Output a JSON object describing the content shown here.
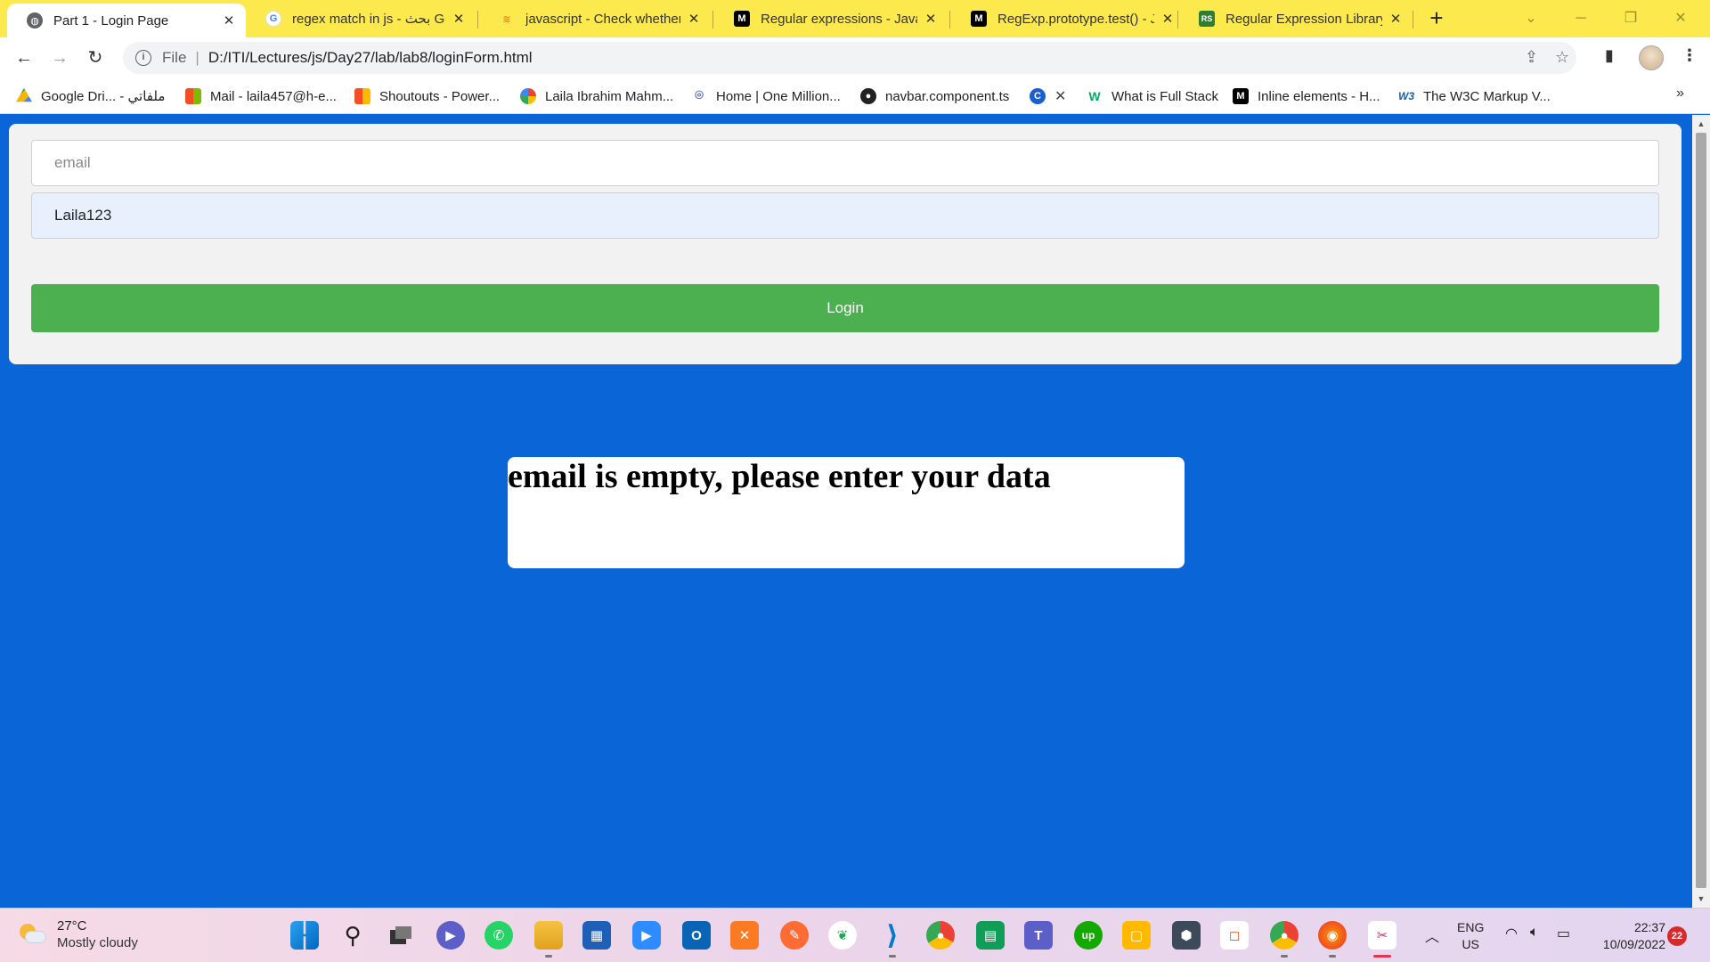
{
  "tabs": [
    {
      "title": "Part 1 - Login Page",
      "icon": "globe-icon",
      "active": true
    },
    {
      "title": "regex match in js - بحث Goo",
      "icon": "google-icon",
      "active": false
    },
    {
      "title": "javascript - Check whether a",
      "icon": "stackoverflow-icon",
      "active": false
    },
    {
      "title": "Regular expressions - JavaS",
      "icon": "mdn-icon",
      "active": false
    },
    {
      "title": "RegExp.prototype.test() - Ja",
      "icon": "mdn-icon",
      "active": false
    },
    {
      "title": "Regular Expression Library",
      "icon": "regexlib-icon",
      "active": false
    }
  ],
  "toolbar": {
    "scheme": "File",
    "url": "D:/ITI/Lectures/js/Day27/lab/lab8/loginForm.html"
  },
  "bookmarks": [
    {
      "label": "Google Dri... - ملفاتي",
      "icon": "google-drive-icon"
    },
    {
      "label": "Mail - laila457@h-e...",
      "icon": "microsoft-icon"
    },
    {
      "label": "Shoutouts - Power...",
      "icon": "microsoft-icon"
    },
    {
      "label": "Laila Ibrahim Mahm...",
      "icon": "pinwheel-icon"
    },
    {
      "label": "Home | One Million...",
      "icon": "location-icon"
    },
    {
      "label": "navbar.component.ts",
      "icon": "github-icon"
    },
    {
      "label": "",
      "icon": "c-logo-icon"
    },
    {
      "label": "",
      "icon": "close-icon"
    },
    {
      "label": "What is Full Stack",
      "icon": "w3-logo-icon"
    },
    {
      "label": "Inline elements - H...",
      "icon": "mdn-icon"
    },
    {
      "label": "The W3C Markup V...",
      "icon": "w3c-icon"
    }
  ],
  "form": {
    "email_placeholder": "email",
    "email_value": "",
    "password_value": "Laila123",
    "login_label": "Login"
  },
  "message": {
    "text": "email is empty, please enter your data"
  },
  "taskbar": {
    "temperature": "27°C",
    "condition": "Mostly cloudy",
    "lang_top": "ENG",
    "lang_bottom": "US",
    "time": "22:37",
    "date": "10/09/2022",
    "notifications": "22"
  },
  "colors": {
    "page_background": "#0a66d6",
    "login_button": "#4caf50",
    "tab_strip": "#fbe94d",
    "autofill_field": "#e8f0fe"
  }
}
